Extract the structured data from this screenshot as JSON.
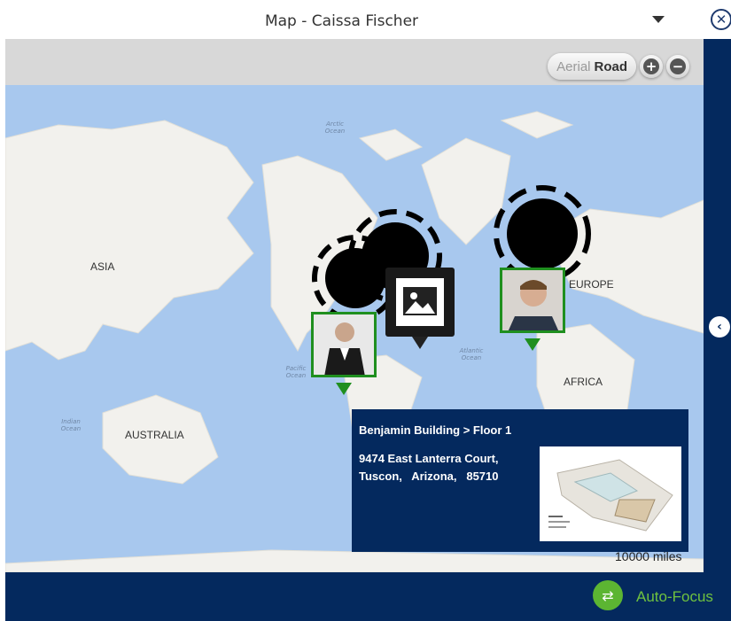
{
  "window": {
    "title": "Map - Caissa Fischer"
  },
  "map": {
    "view_toggle": {
      "aerial": "Aerial",
      "road": "Road"
    },
    "continents": [
      "ASIA",
      "EUROPE",
      "AFRICA",
      "AUSTRALIA"
    ],
    "oceans": [
      "Arctic Ocean",
      "Pacific Ocean",
      "Atlantic Ocean",
      "Indian Ocean"
    ],
    "scale_label": "10000 miles"
  },
  "popup": {
    "title": "Benjamin Building > Floor 1",
    "address_line1": "9474 East Lanterra Court,",
    "address_line2": "Tuscon,   Arizona,   85710"
  },
  "footer": {
    "autofocus_label": "Auto-Focus"
  }
}
